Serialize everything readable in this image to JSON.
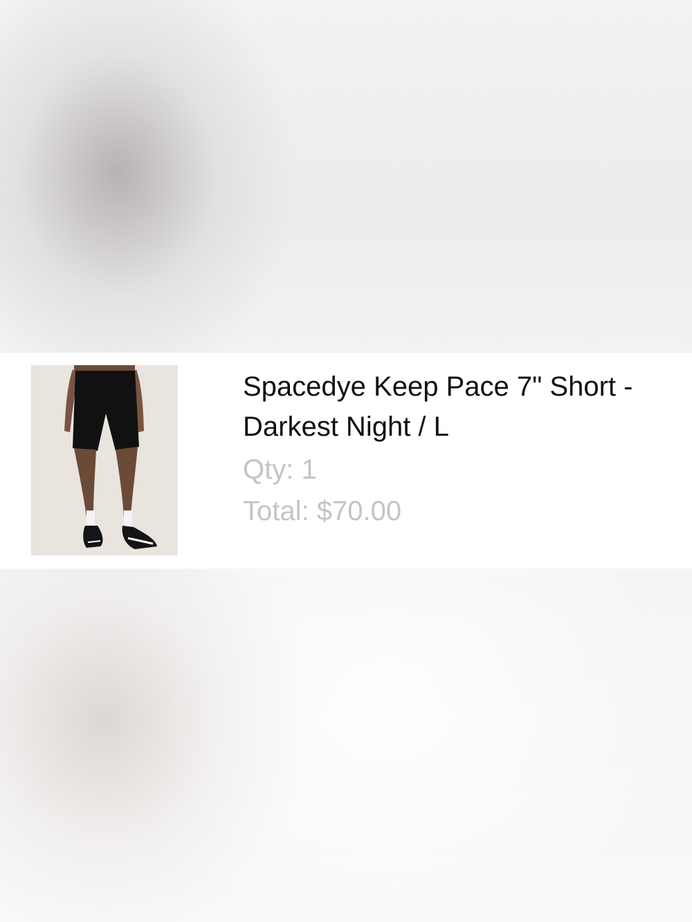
{
  "product": {
    "title": "Spacedye Keep Pace 7\" Short - Darkest Night / L",
    "qty_label": "Qty: 1",
    "total_label": "Total: $70.00",
    "image_icon": "product-photo-shorts"
  },
  "colors": {
    "title_text": "#111111",
    "meta_text": "#c4c4c4",
    "card_bg": "#ffffff",
    "photo_bg": "#e9e4de"
  }
}
